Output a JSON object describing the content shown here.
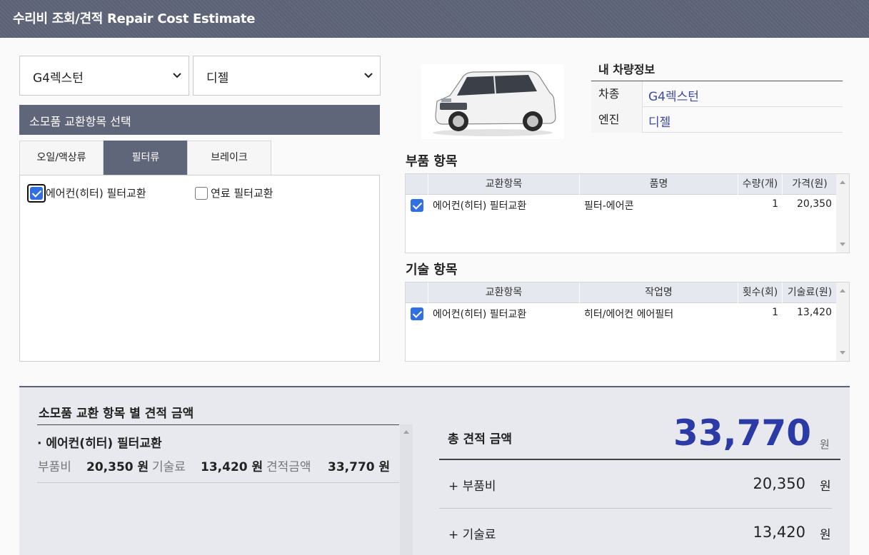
{
  "header": {
    "title": "수리비 조회/견적 Repair Cost Estimate"
  },
  "selects": {
    "model": "G4렉스턴",
    "engine": "디젤"
  },
  "consumables": {
    "section_title": "소모품 교환항목 선택",
    "tabs": [
      {
        "label": "오일/액상류",
        "active": false
      },
      {
        "label": "필터류",
        "active": true
      },
      {
        "label": "브레이크",
        "active": false
      }
    ],
    "items": [
      {
        "label": "에어컨(히터) 필터교환",
        "checked": true
      },
      {
        "label": "연료 필터교환",
        "checked": false
      }
    ]
  },
  "vehicle": {
    "title": "내 차량정보",
    "rows": [
      {
        "key": "차종",
        "value": "G4렉스턴"
      },
      {
        "key": "엔진",
        "value": "디젤"
      }
    ]
  },
  "parts": {
    "title": "부품 항목",
    "headers": [
      "교환항목",
      "품명",
      "수량(개)",
      "가격(원)"
    ],
    "rows": [
      {
        "checked": true,
        "item": "에어컨(히터) 필터교환",
        "name": "필터-에어콘",
        "qty": "1",
        "price": "20,350"
      }
    ]
  },
  "labor": {
    "title": "기술 항목",
    "headers": [
      "교환항목",
      "작업명",
      "횟수(회)",
      "기술료(원)"
    ],
    "rows": [
      {
        "checked": true,
        "item": "에어컨(히터) 필터교환",
        "name": "히터/에어컨 에어필터",
        "qty": "1",
        "price": "13,420"
      }
    ]
  },
  "summary": {
    "title": "소모품 교환 항목 별 견적 금액",
    "items": [
      {
        "name": "· 에어컨(히터) 필터교환",
        "parts_label": "부품비",
        "parts_value": "20,350 원",
        "labor_label": "기술료",
        "labor_value": "13,420 원",
        "est_label": "견적금액",
        "est_value": "33,770 원"
      }
    ],
    "total_label": "총 견적 금액",
    "total_value": "33,770",
    "unit": "원",
    "breakdown": [
      {
        "label": "+ 부품비",
        "value": "20,350",
        "unit": "원"
      },
      {
        "label": "+ 기술료",
        "value": "13,420",
        "unit": "원"
      }
    ]
  }
}
